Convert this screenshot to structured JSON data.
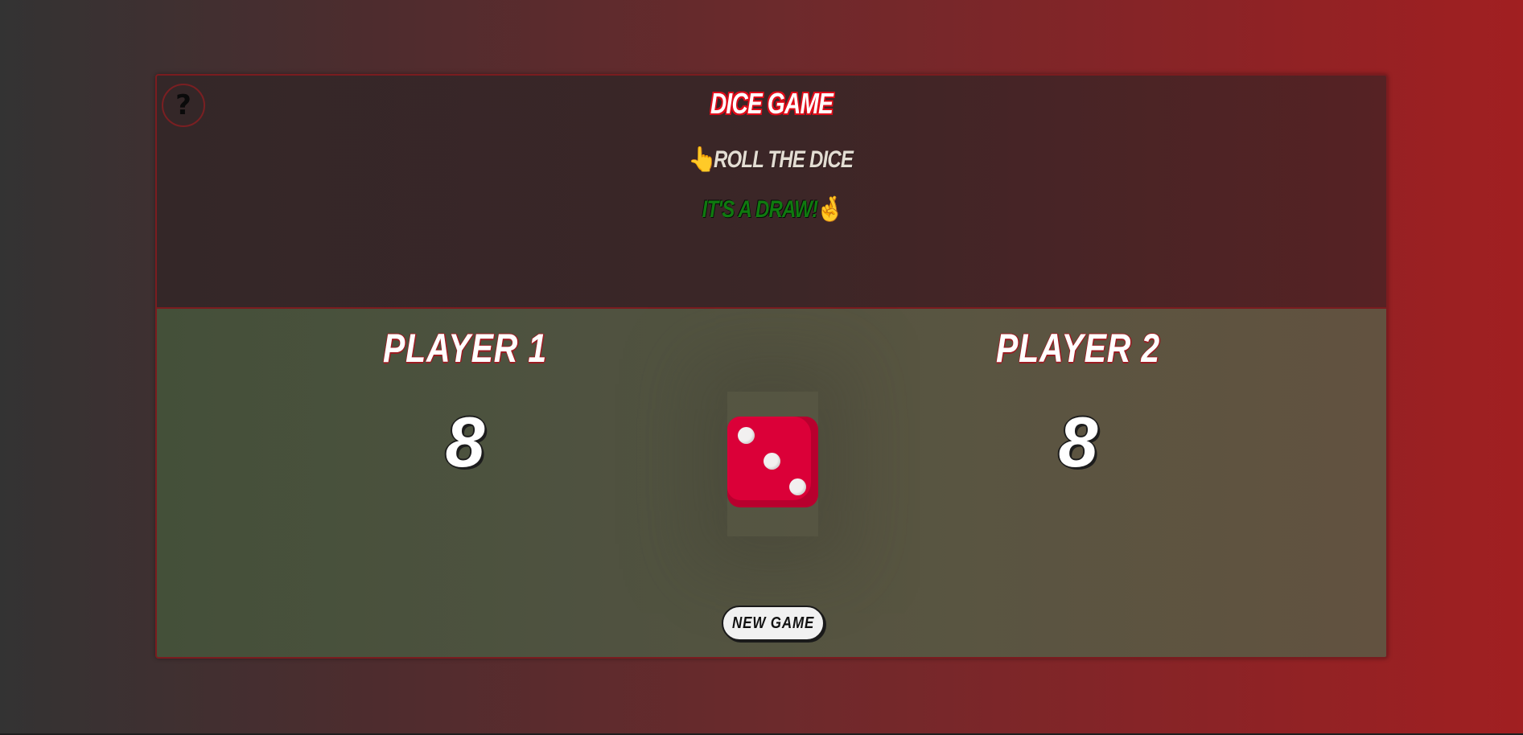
{
  "header": {
    "title": "DICE GAME",
    "help_label": "?",
    "instruction_emoji": "👆",
    "instruction_text": "ROLL THE DICE",
    "result_text": "IT'S A DRAW!",
    "result_emoji": "🤞"
  },
  "players": [
    {
      "name": "PLAYER 1",
      "score": "8"
    },
    {
      "name": "PLAYER 2",
      "score": "8"
    }
  ],
  "dice": {
    "value": 3,
    "color": "#db0038",
    "pip_color": "#f2f0f0"
  },
  "controls": {
    "new_game_label": "NEW GAME"
  },
  "colors": {
    "title_outline": "#e00d1a",
    "result_text": "#0f7a0f",
    "frame_border": "#7a1c1f"
  }
}
